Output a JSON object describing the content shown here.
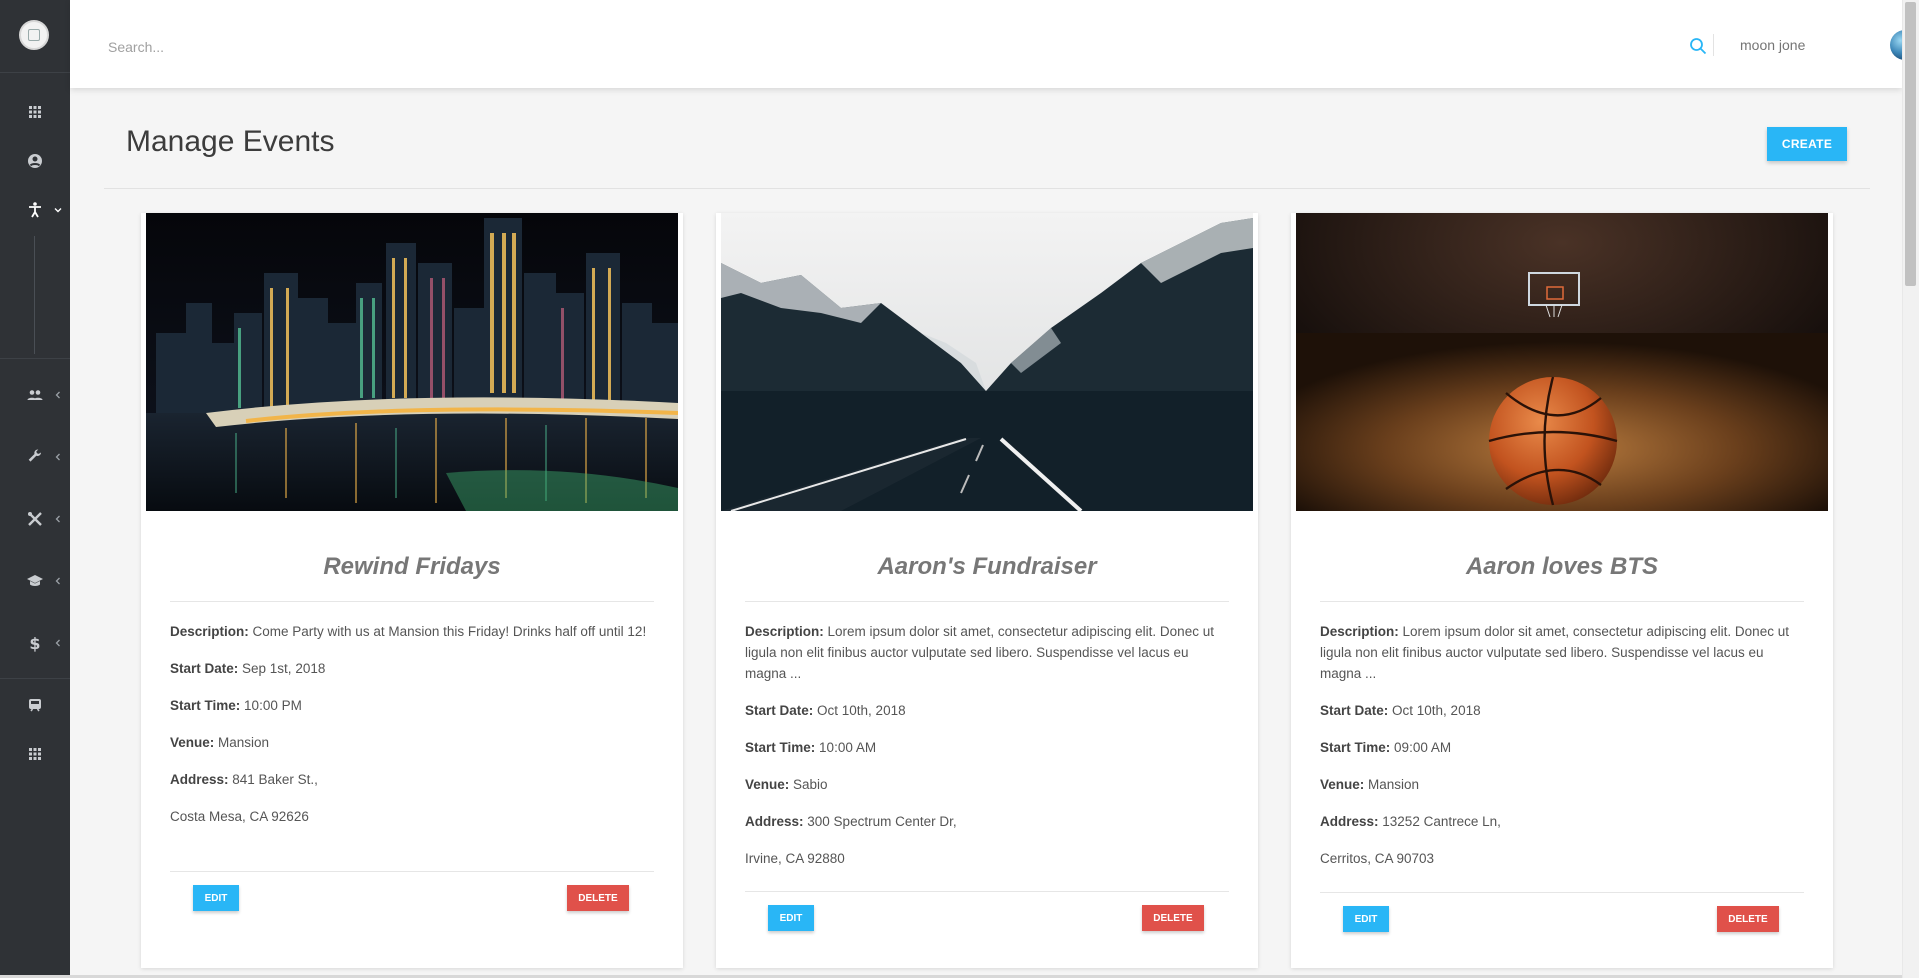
{
  "topbar": {
    "search_placeholder": "Search...",
    "user_name": "moon jone"
  },
  "sidebar": {
    "items": [
      {
        "icon": "apps-grid-icon"
      },
      {
        "icon": "account-circle-icon"
      },
      {
        "icon": "accessibility-icon",
        "expanded": true
      },
      {
        "icon": "people-icon"
      },
      {
        "icon": "wrench-icon"
      },
      {
        "icon": "tools-icon"
      },
      {
        "icon": "school-icon"
      },
      {
        "icon": "dollar-icon"
      },
      {
        "icon": "train-icon"
      },
      {
        "icon": "apps-grid-icon"
      }
    ]
  },
  "page": {
    "title": "Manage Events",
    "create_label": "CREATE"
  },
  "labels": {
    "description": "Description:",
    "start_date": "Start Date:",
    "start_time": "Start Time:",
    "venue": "Venue:",
    "address": "Address:",
    "edit": "EDIT",
    "delete": "DELETE"
  },
  "events": [
    {
      "title": "Rewind Fridays",
      "image": "night-city-skyline-bridge",
      "description": "Come Party with us at Mansion this Friday! Drinks half off until 12!",
      "start_date": "Sep 1st, 2018",
      "start_time": "10:00 PM",
      "venue": "Mansion",
      "address_line1": "841 Baker St.,",
      "address_line2": "Costa Mesa, CA 92626"
    },
    {
      "title": "Aaron's Fundraiser",
      "image": "mountain-valley-road",
      "description": "Lorem ipsum dolor sit amet, consectetur adipiscing elit. Donec ut ligula non elit finibus auctor vulputate sed libero. Suspendisse vel lacus eu magna ...",
      "start_date": "Oct 10th, 2018",
      "start_time": "10:00 AM",
      "venue": "Sabio",
      "address_line1": "300 Spectrum Center Dr,",
      "address_line2": "Irvine, CA 92880"
    },
    {
      "title": "Aaron loves BTS",
      "image": "basketball-court",
      "description": "Lorem ipsum dolor sit amet, consectetur adipiscing elit. Donec ut ligula non elit finibus auctor vulputate sed libero. Suspendisse vel lacus eu magna ...",
      "start_date": "Oct 10th, 2018",
      "start_time": "09:00 AM",
      "venue": "Mansion",
      "address_line1": "13252 Cantrece Ln,",
      "address_line2": "Cerritos, CA 90703"
    }
  ],
  "colors": {
    "sidebar_bg": "#2f3236",
    "primary": "#29b6f6",
    "danger": "#e0514a",
    "page_bg": "#f5f5f5"
  }
}
